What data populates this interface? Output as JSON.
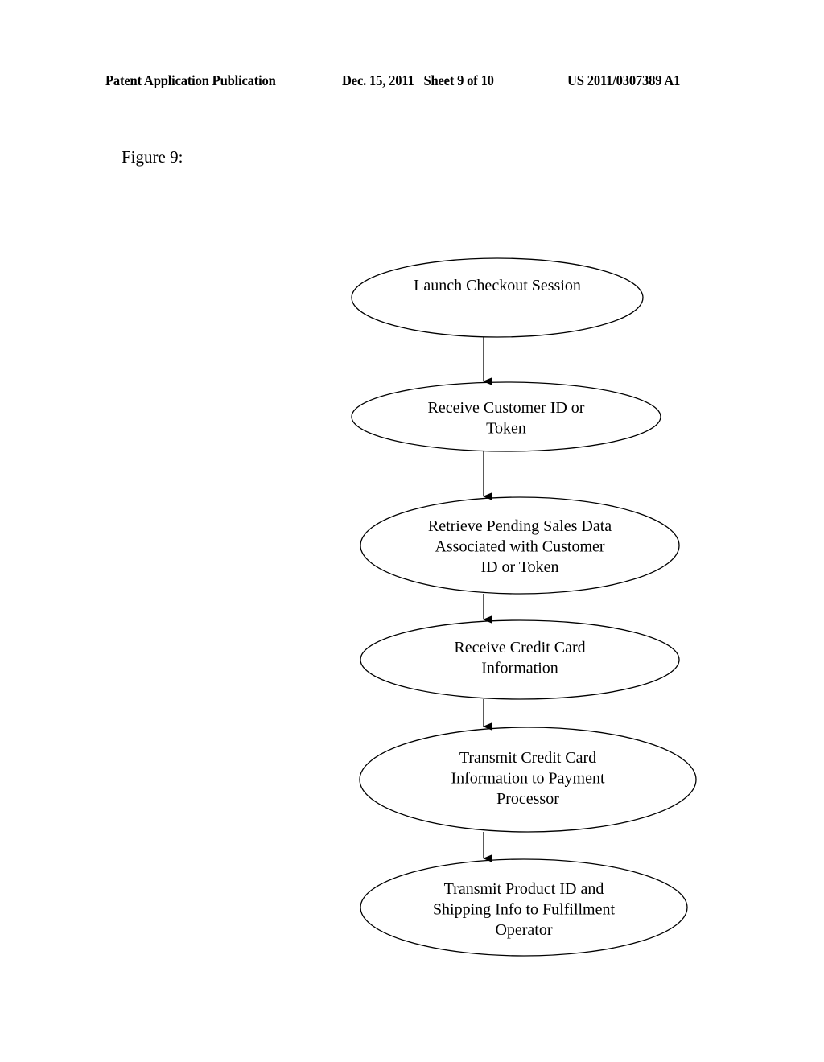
{
  "header": {
    "publication": "Patent Application Publication",
    "date_sheet": "Dec. 15, 2011   Sheet 9 of 10",
    "number": "US 2011/0307389 A1"
  },
  "figure": {
    "label": "Figure 9:"
  },
  "flowchart": {
    "nodes": [
      {
        "id": "n1",
        "lines": [
          "Launch Checkout Session"
        ]
      },
      {
        "id": "n2",
        "lines": [
          "Receive Customer ID or",
          "Token"
        ]
      },
      {
        "id": "n3",
        "lines": [
          "Retrieve Pending Sales Data",
          "Associated with Customer",
          "ID or Token"
        ]
      },
      {
        "id": "n4",
        "lines": [
          "Receive Credit Card",
          "Information"
        ]
      },
      {
        "id": "n5",
        "lines": [
          "Transmit Credit Card",
          "Information to Payment",
          "Processor"
        ]
      },
      {
        "id": "n6",
        "lines": [
          "Transmit Product ID and",
          "Shipping Info to Fulfillment",
          "Operator"
        ]
      }
    ],
    "edges": [
      {
        "from": "n1",
        "to": "n2"
      },
      {
        "from": "n2",
        "to": "n3"
      },
      {
        "from": "n3",
        "to": "n4"
      },
      {
        "from": "n4",
        "to": "n5"
      },
      {
        "from": "n5",
        "to": "n6"
      }
    ]
  }
}
